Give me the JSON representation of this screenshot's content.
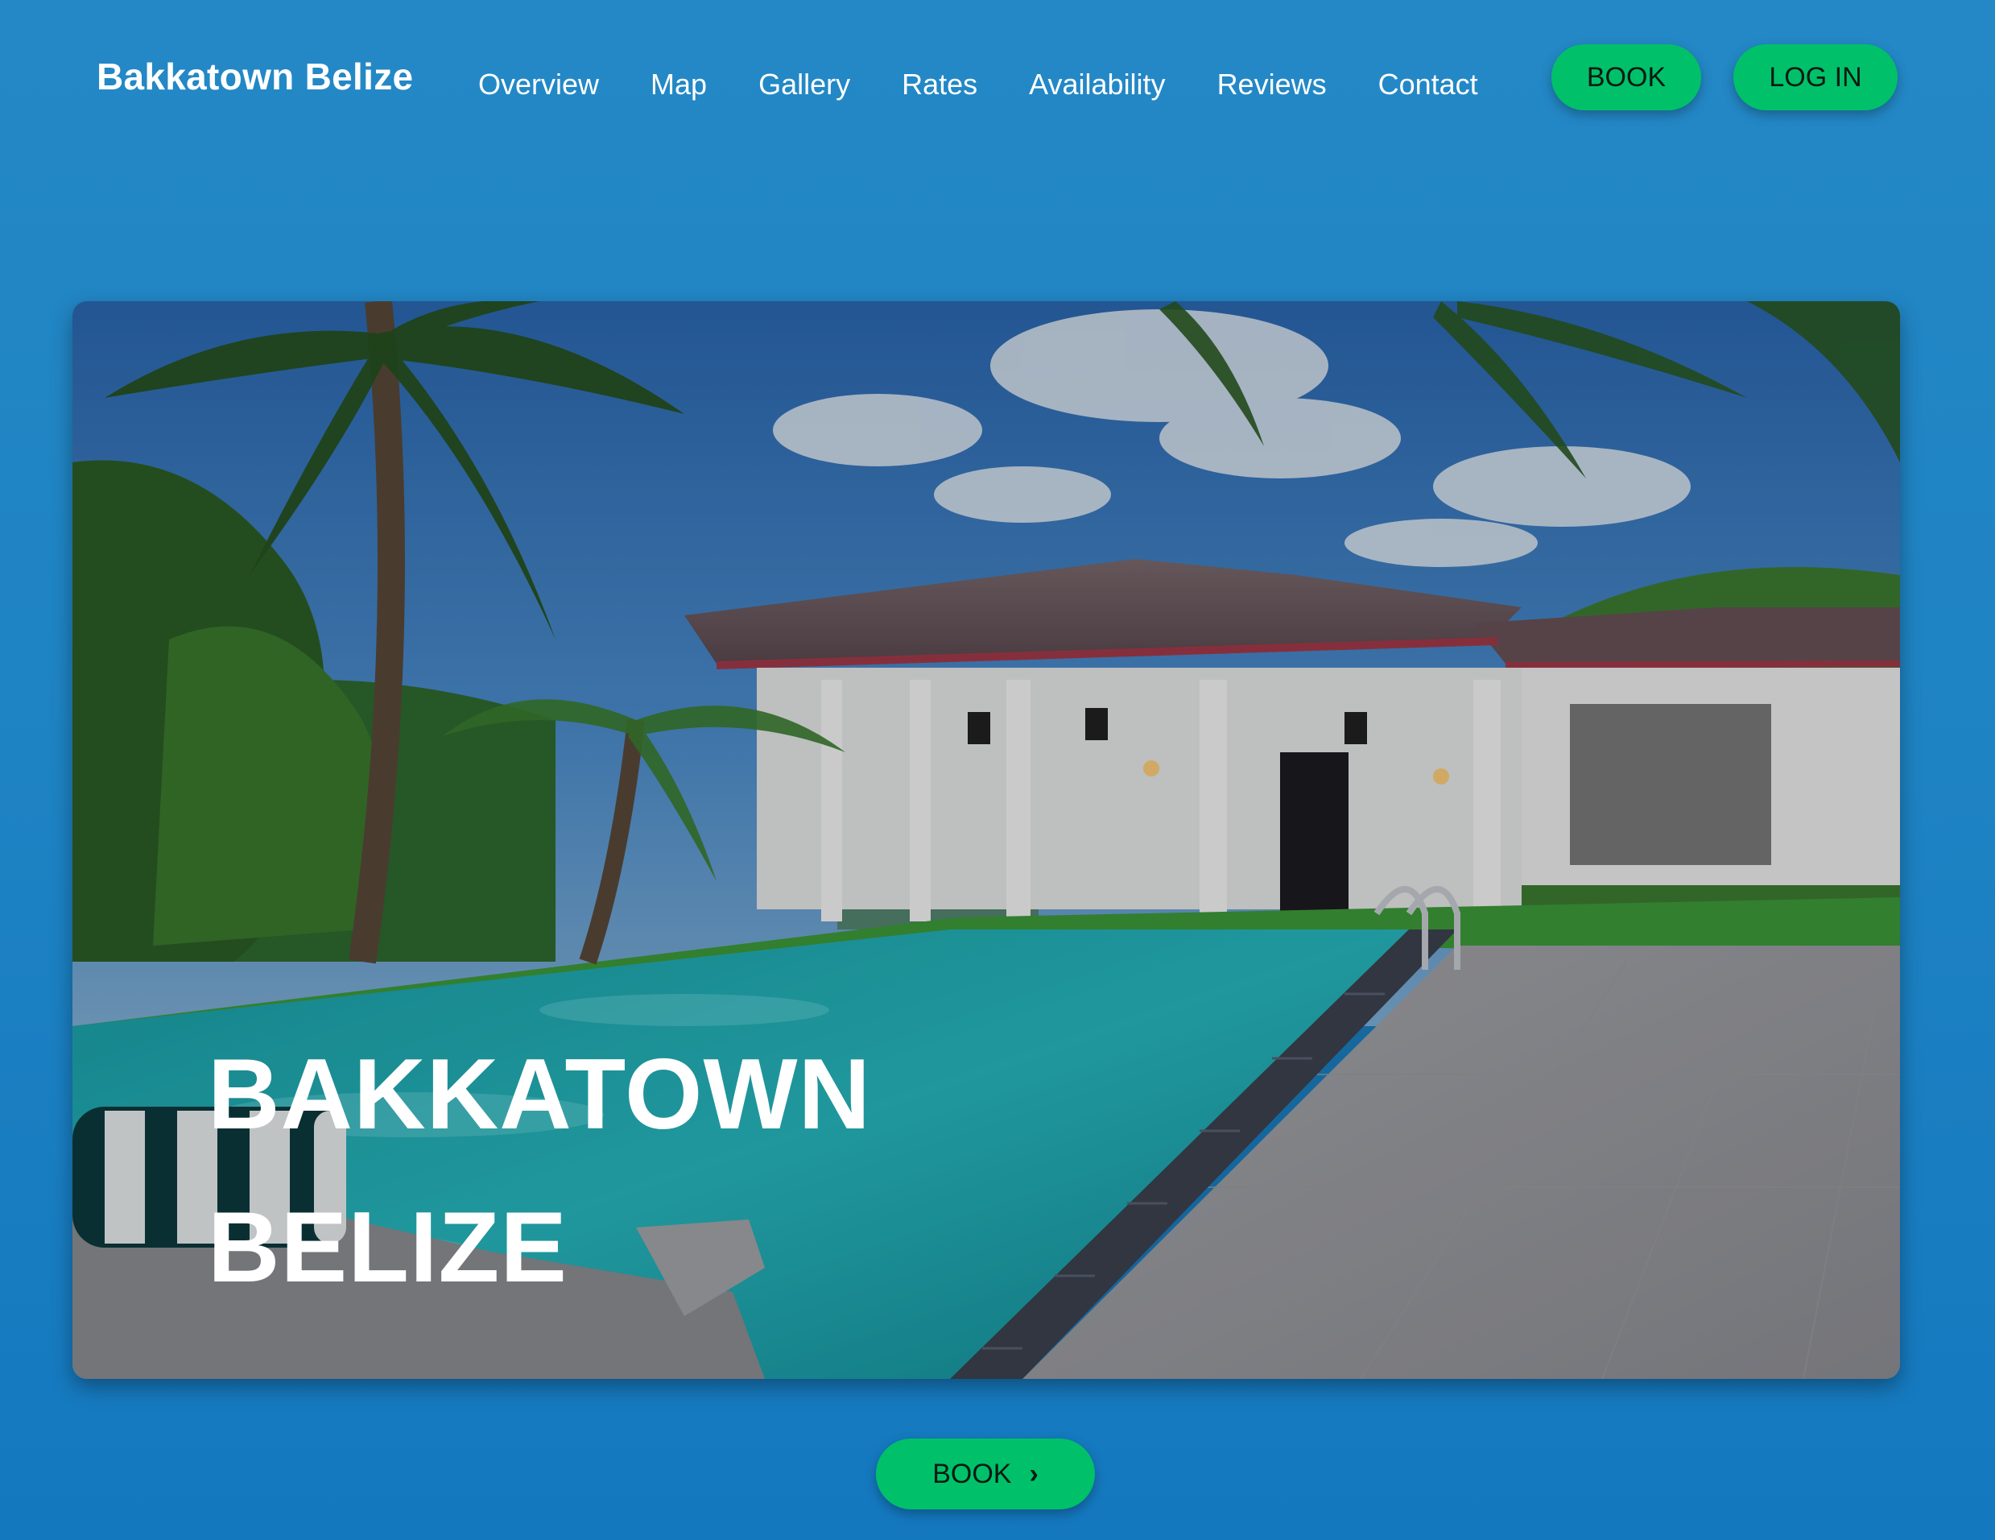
{
  "header": {
    "brand": "Bakkatown Belize",
    "nav": [
      "Overview",
      "Map",
      "Gallery",
      "Rates",
      "Availability",
      "Reviews",
      "Contact"
    ],
    "book_label": "BOOK",
    "login_label": "LOG IN"
  },
  "hero": {
    "title_line1": "BAKKATOWN",
    "title_line2": "BELIZE"
  },
  "cta": {
    "book_label": "BOOK",
    "chevron_icon": "chevron-right-icon"
  },
  "colors": {
    "background": "#1e83c3",
    "accent_button": "#00c16a",
    "button_text": "#0b1a12",
    "text_light": "#ffffff"
  }
}
